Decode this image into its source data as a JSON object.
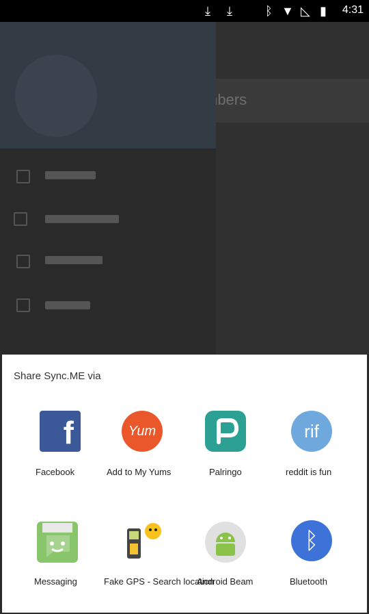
{
  "status_bar": {
    "time": "4:31",
    "icons": [
      "download-icon",
      "download-icon",
      "bluetooth-icon",
      "wifi-icon",
      "no-signal-icon",
      "battery-charging-icon"
    ]
  },
  "background": {
    "search_hint": "mbers"
  },
  "modal": {
    "title": "Share Sync.ME via",
    "apps": [
      {
        "label": "Facebook",
        "icon": "facebook-icon",
        "glyph": "f"
      },
      {
        "label": "Add to My Yums",
        "icon": "yum-icon",
        "glyph": "Yum"
      },
      {
        "label": "Palringo",
        "icon": "palringo-icon",
        "glyph": ""
      },
      {
        "label": "reddit is fun",
        "icon": "reddit-is-fun-icon",
        "glyph": "rif"
      },
      {
        "label": "Messaging",
        "icon": "messaging-icon",
        "glyph": ""
      },
      {
        "label": "Fake GPS - Search location",
        "icon": "fake-gps-icon",
        "glyph": ""
      },
      {
        "label": "Android Beam",
        "icon": "android-beam-icon",
        "glyph": ""
      },
      {
        "label": "Bluetooth",
        "icon": "bluetooth-icon",
        "glyph": "ᛒ"
      }
    ]
  }
}
